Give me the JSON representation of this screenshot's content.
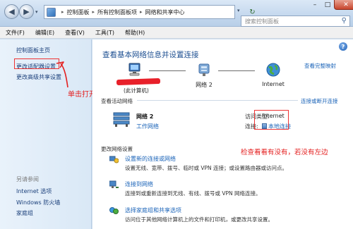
{
  "window": {
    "minimize": "–",
    "maximize": "□",
    "close": "✕"
  },
  "nav": {
    "back": "◀",
    "forward": "▶",
    "history": "▾"
  },
  "address": {
    "crumbs": [
      "控制面板",
      "所有控制面板项",
      "网络和共享中心"
    ],
    "separator": "▸",
    "dropdown": "▾",
    "refresh": "↻"
  },
  "search": {
    "placeholder": "搜索控制面板",
    "icon": "search-icon"
  },
  "menu": [
    "文件(F)",
    "编辑(E)",
    "查看(V)",
    "工具(T)",
    "帮助(H)"
  ],
  "sidebar": {
    "home": "控制面板主页",
    "adapter": "更改适配器设置",
    "advanced": "更改高级共享设置",
    "see_also_title": "另请参阅",
    "see_also": [
      "Internet 选项",
      "Windows 防火墙",
      "家庭组"
    ]
  },
  "annotations": {
    "click_open": "单击打开",
    "check_local": "检查看看有没有，若没有左边"
  },
  "main": {
    "help": "?",
    "title": "查看基本网络信息并设置连接",
    "full_map": "查看完整映射",
    "nodes": {
      "pc_sub": "(此计算机)",
      "network": "网络 2",
      "internet": "Internet"
    },
    "active": {
      "title": "查看活动网络",
      "connect_link": "连接或断开连接",
      "net_name": "网络 2",
      "net_type": "工作网络",
      "access_label": "访问类型:",
      "access_value": "Internet",
      "conn_label": "连接:",
      "conn_value": "本地连接"
    },
    "change": {
      "title": "更改网络设置",
      "tasks": [
        {
          "title": "设置新的连接或网络",
          "desc": "设置无线、宽带、拨号、临时或 VPN 连接；或设置路由器或访问点。",
          "icon": "new-connection-icon"
        },
        {
          "title": "连接到网络",
          "desc": "连接到或重新连接到无线、有线、拨号或 VPN 网络连接。",
          "icon": "connect-network-icon"
        },
        {
          "title": "选择家庭组和共享选项",
          "desc": "访问位于其他网络计算机上的文件和打印机，或更改共享设置。",
          "icon": "homegroup-icon"
        }
      ]
    }
  },
  "colors": {
    "link": "#1a63b8",
    "title": "#1d4f91",
    "annotation": "#e42020"
  }
}
